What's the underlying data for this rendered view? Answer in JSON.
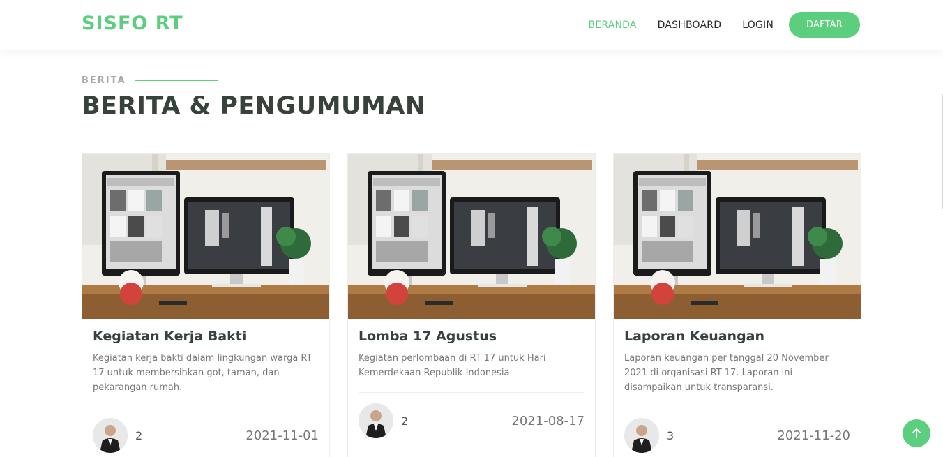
{
  "header": {
    "logo": "SISFO RT",
    "nav": {
      "home": "BERANDA",
      "dashboard": "DASHBOARD",
      "login": "LOGIN",
      "register": "DAFTAR"
    }
  },
  "section": {
    "eyebrow": "BERITA",
    "title": "BERITA & PENGUMUMAN"
  },
  "cards": [
    {
      "title": "Kegiatan Kerja Bakti",
      "text": "Kegiatan kerja bakti dalam lingkungan warga RT 17 untuk membersihkan got, taman, dan pekarangan rumah.",
      "count": "2",
      "date": "2021-11-01"
    },
    {
      "title": "Lomba 17 Agustus",
      "text": "Kegiatan perlombaan di RT 17 untuk Hari Kemerdekaan Republik Indonesia",
      "count": "2",
      "date": "2021-08-17"
    },
    {
      "title": "Laporan Keuangan",
      "text": "Laporan keuangan per tanggal 20 November 2021 di organisasi RT 17. Laporan ini disampaikan untuk transparansi.",
      "count": "3",
      "date": "2021-11-20"
    }
  ],
  "icons": {
    "back_to_top": "arrow-up-icon"
  },
  "colors": {
    "accent": "#5ccf7e",
    "title": "#37423b"
  }
}
